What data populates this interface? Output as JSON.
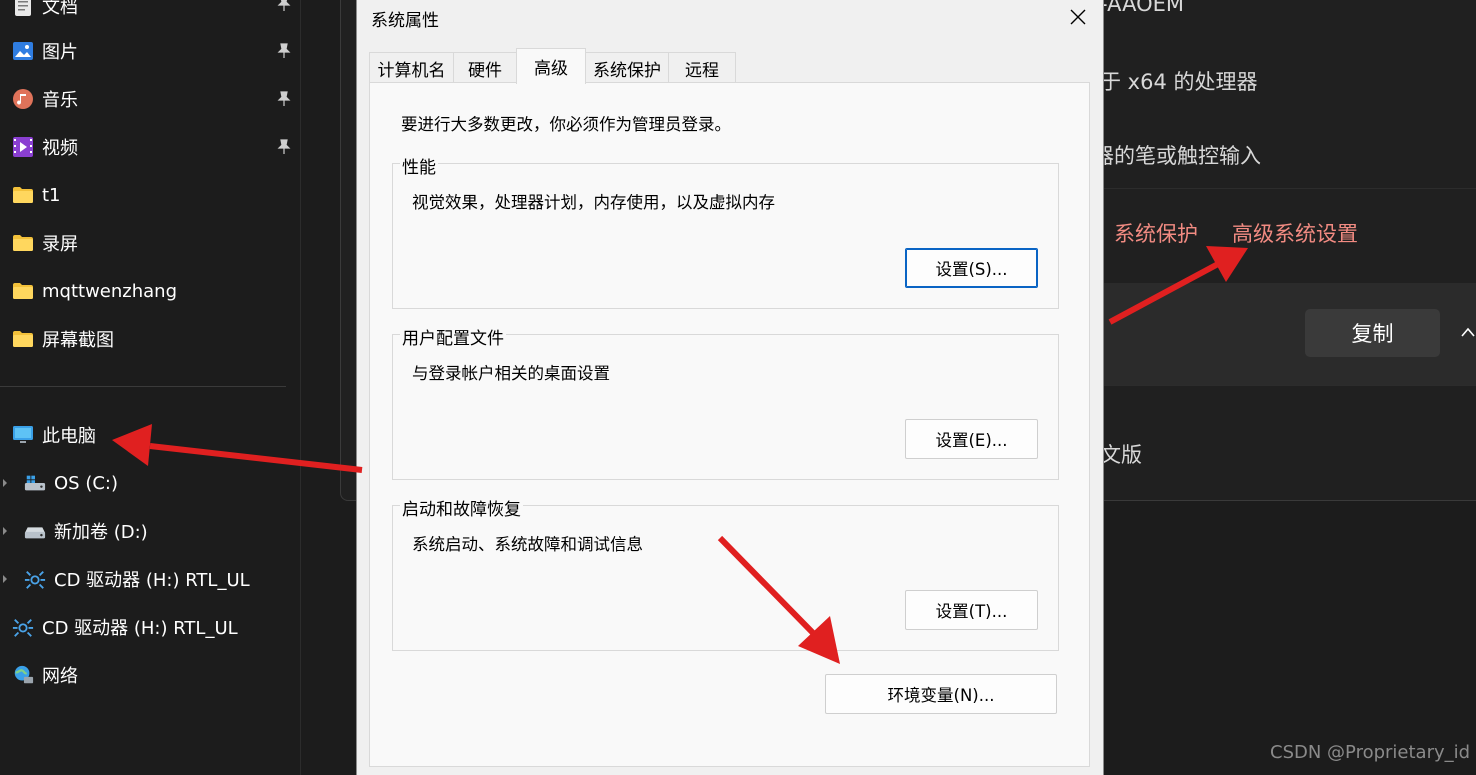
{
  "explorer": {
    "quick_access": [
      {
        "label": "文档",
        "icon": "document-icon",
        "pinned": true
      },
      {
        "label": "图片",
        "icon": "pictures-icon",
        "pinned": true
      },
      {
        "label": "音乐",
        "icon": "music-icon",
        "pinned": true
      },
      {
        "label": "视频",
        "icon": "videos-icon",
        "pinned": true
      },
      {
        "label": "t1",
        "icon": "folder-icon",
        "pinned": false
      },
      {
        "label": "录屏",
        "icon": "folder-icon",
        "pinned": false
      },
      {
        "label": "mqttwenzhang",
        "icon": "folder-icon",
        "pinned": false
      },
      {
        "label": "屏幕截图",
        "icon": "folder-icon",
        "pinned": false
      }
    ],
    "this_pc": {
      "label": "此电脑",
      "icon": "monitor-icon"
    },
    "drives": [
      {
        "label": "OS (C:)",
        "icon": "os-drive-icon"
      },
      {
        "label": "新加卷 (D:)",
        "icon": "drive-icon"
      },
      {
        "label": "CD 驱动器 (H:) RTL_UL",
        "icon": "cd-drive-icon"
      }
    ],
    "cd_drive": {
      "label": "CD 驱动器 (H:) RTL_UL",
      "icon": "cd-drive-icon"
    },
    "network": {
      "label": "网络",
      "icon": "network-icon"
    }
  },
  "settings_bg": {
    "device_name_fragment": "-AAOEM",
    "processor_fragment": "于 x64 的处理器",
    "pen_fragment": "器的笔或触控输入",
    "links": {
      "system_protection": "系统保护",
      "advanced_settings": "高级系统设置"
    },
    "copy_label": "复制",
    "edition_fragment": "文版",
    "accent_color": "#f28b82"
  },
  "dialog": {
    "title": "系统属性",
    "tabs": [
      {
        "label": "计算机名",
        "active": false
      },
      {
        "label": "硬件",
        "active": false
      },
      {
        "label": "高级",
        "active": true
      },
      {
        "label": "系统保护",
        "active": false
      },
      {
        "label": "远程",
        "active": false
      }
    ],
    "admin_notice": "要进行大多数更改，你必须作为管理员登录。",
    "groups": {
      "performance": {
        "title": "性能",
        "description": "视觉效果，处理器计划，内存使用，以及虚拟内存",
        "button": "设置(S)..."
      },
      "user_profiles": {
        "title": "用户配置文件",
        "description": "与登录帐户相关的桌面设置",
        "button": "设置(E)..."
      },
      "startup": {
        "title": "启动和故障恢复",
        "description": "系统启动、系统故障和调试信息",
        "button": "设置(T)..."
      }
    },
    "env_button": "环境变量(N)..."
  },
  "watermark": "CSDN @Proprietary_id",
  "annotation_color": "#e02020"
}
